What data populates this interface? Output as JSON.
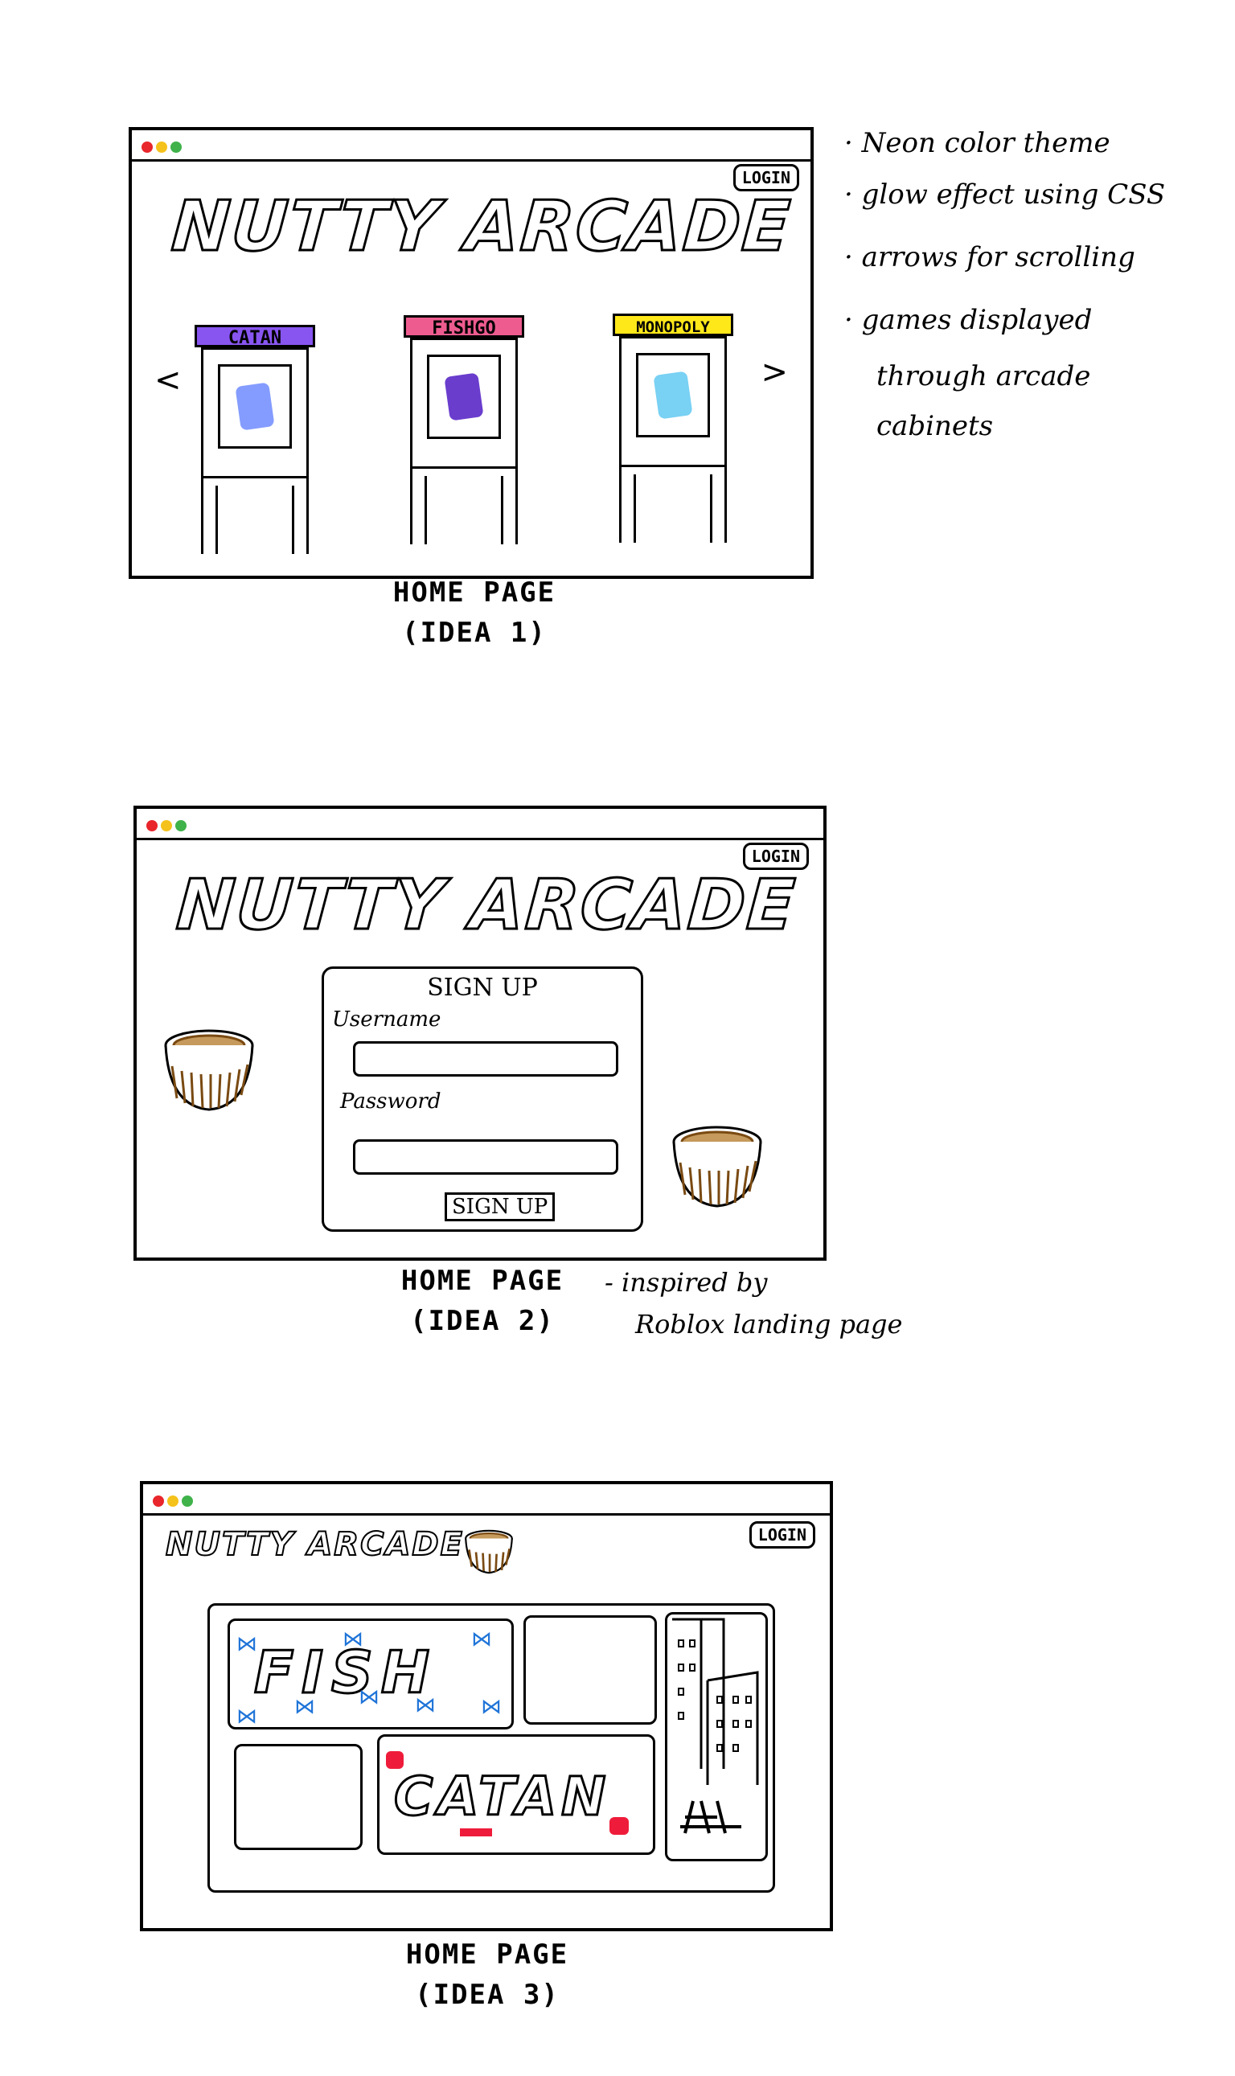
{
  "colors": {
    "dot_red": "#e8262b",
    "dot_yellow": "#f5c21b",
    "dot_green": "#3fb24a",
    "catan_purple": "#8855f0",
    "fish_pink": "#ee5c8f",
    "monopoly_yellow": "#ffe81a",
    "swatch_blue": "#6f8bff",
    "swatch_purple": "#5a28c8",
    "swatch_cyan": "#62c9f2",
    "coconut_brown": "#7a4a12",
    "catan_red": "#ee1c3a",
    "fish_blue": "#1f74d8"
  },
  "idea1": {
    "login": "LOGIN",
    "logo": "NUTTY ARCADE",
    "prev_arrow": "<",
    "next_arrow": ">",
    "cabinets": [
      {
        "label": "CATAN"
      },
      {
        "label": "FISHGO"
      },
      {
        "label": "MONOPOLY"
      }
    ],
    "caption_line1": "HOME PAGE",
    "caption_line2": "(IDEA 1)"
  },
  "notes": [
    "Neon color theme",
    "glow effect using CSS",
    "arrows for scrolling",
    "games displayed",
    "through arcade",
    "cabinets"
  ],
  "idea2": {
    "login": "LOGIN",
    "logo": "NUTTY ARCADE",
    "form_title": "SIGN UP",
    "username_label": "Username",
    "password_label": "Password",
    "button_label": "SIGN UP",
    "caption_line1": "HOME PAGE",
    "caption_line2": "(IDEA 2)",
    "side_note_line1": "- inspired by",
    "side_note_line2": "Roblox landing page"
  },
  "idea3": {
    "login": "LOGIN",
    "logo": "NUTTY ARCADE",
    "fish_tile": "FISH",
    "catan_tile": "CATAN",
    "caption_line1": "HOME PAGE",
    "caption_line2": "(IDEA 3)"
  }
}
